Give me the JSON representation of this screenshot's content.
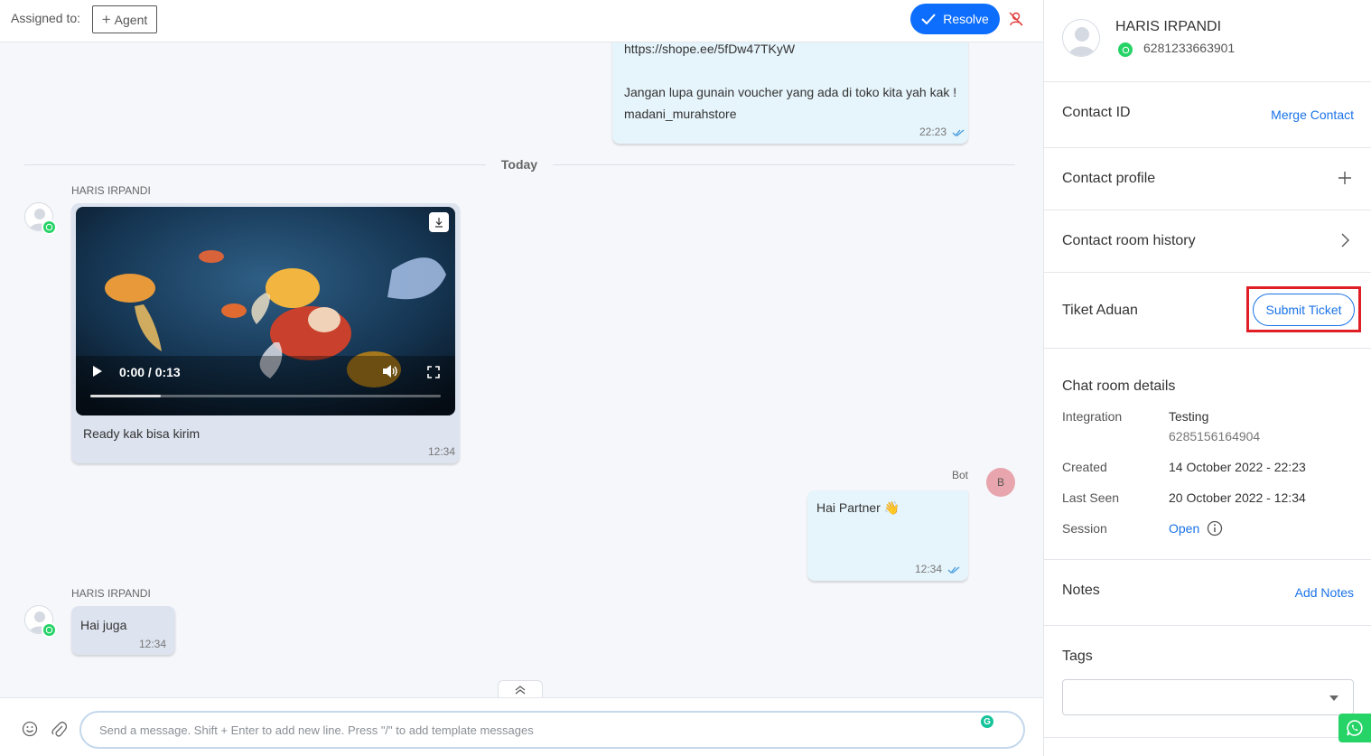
{
  "topbar": {
    "assigned_label": "Assigned to:",
    "agent_button": "Agent",
    "resolve_button": "Resolve"
  },
  "messages": {
    "previous": {
      "link": "https://shope.ee/5fDw47TKyW",
      "line1": "Jangan lupa gunain voucher yang ada di toko kita yah kak !",
      "line2": "madani_murahstore",
      "time": "22:23"
    },
    "date_separator": "Today",
    "video_message": {
      "sender": "HARIS IRPANDI",
      "video_time": "0:00 / 0:13",
      "video_progress_percent": 20,
      "caption": "Ready kak bisa kirim",
      "time": "12:34"
    },
    "bot_message": {
      "sender": "Bot",
      "avatar_initial": "B",
      "text": "Hai Partner 👋",
      "time": "12:34"
    },
    "reply_message": {
      "sender": "HARIS IRPANDI",
      "text": "Hai juga",
      "time": "12:34"
    }
  },
  "composer": {
    "placeholder": "Send a message. Shift + Enter to add new line. Press \"/\" to add template messages",
    "grammarly_letter": "G"
  },
  "contact": {
    "name": "HARIS IRPANDI",
    "phone": "6281233663901"
  },
  "sections": {
    "contact_id": {
      "title": "Contact ID",
      "link": "Merge Contact"
    },
    "contact_profile": {
      "title": "Contact profile"
    },
    "room_history": {
      "title": "Contact room history"
    },
    "tiket": {
      "title": "Tiket Aduan",
      "button": "Submit Ticket"
    },
    "details": {
      "title": "Chat room details",
      "integration_label": "Integration",
      "integration_value": "Testing",
      "integration_number": "6285156164904",
      "created_label": "Created",
      "created_value": "14 October 2022 - 22:23",
      "last_seen_label": "Last Seen",
      "last_seen_value": "20 October 2022 - 12:34",
      "session_label": "Session",
      "session_value": "Open"
    },
    "notes": {
      "title": "Notes",
      "link": "Add Notes"
    },
    "tags": {
      "title": "Tags"
    }
  },
  "colors": {
    "accent": "#0d6efd",
    "link": "#1a73e8",
    "whatsapp": "#25d366",
    "highlight": "#e01e26"
  }
}
